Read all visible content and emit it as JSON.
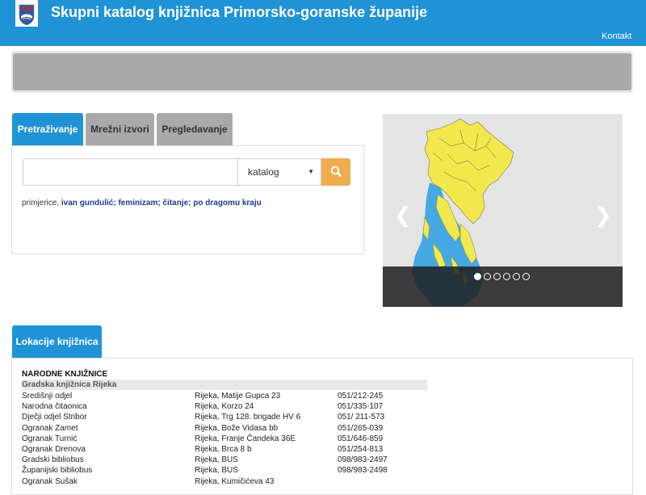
{
  "header": {
    "logo_icon": "county-coat-of-arms",
    "title": "Skupni katalog knjižnica Primorsko-goranske županije",
    "nav_contact": "Kontakt",
    "background": "#1f93d6"
  },
  "search": {
    "tabs": [
      {
        "label": "Pretraživanje",
        "active": true
      },
      {
        "label": "Mrežni izvori",
        "active": false
      },
      {
        "label": "Pregledavanje",
        "active": false
      }
    ],
    "input_value": "",
    "input_placeholder": "",
    "select_value": "katalog",
    "button_icon": "search-icon",
    "button_color": "#f0ad4e",
    "examples_prefix": "primjerice,",
    "examples": [
      "ivan gundulić;",
      "feminizam;",
      "čitanje;",
      "po dragomu kraju"
    ]
  },
  "carousel": {
    "prev_icon": "chevron-left-icon",
    "next_icon": "chevron-right-icon",
    "slide_icon": "county-map-image",
    "slide_count": 6,
    "active_slide": 1
  },
  "locations": {
    "tab_label": "Lokacije knjižnica",
    "heading": "NARODNE KNJIŽNICE",
    "subheading": "Gradska knjižnica Rijeka",
    "rows": [
      {
        "name": "Središnji odjel",
        "address": "Rijeka, Matije Gupca 23",
        "phone": "051/212-245"
      },
      {
        "name": "Narodna čitaonica",
        "address": "Rijeka, Korzo 24",
        "phone": "051/335-107"
      },
      {
        "name": "Dječji odjel Stribor",
        "address": "Rijeka, Trg 128. brigade HV 6",
        "phone": "051/ 211-573"
      },
      {
        "name": "Ogranak Zamet",
        "address": "Rijeka, Bože Vidasa bb",
        "phone": "051/265-039"
      },
      {
        "name": "Ogranak Turnić",
        "address": "Rijeka, Franje Čandeka 36E",
        "phone": "051/646-859"
      },
      {
        "name": "Ogranak Drenova",
        "address": "Rijeka, Brca 8 b",
        "phone": "051/254-813"
      },
      {
        "name": "Gradski bibliobus",
        "address": "Rijeka, BUS",
        "phone": "098/983-2497"
      },
      {
        "name": "Županijski bibliobus",
        "address": "Rijeka, BUS",
        "phone": "098/983-2498"
      },
      {
        "name": "Ogranak Sušak",
        "address": "Rijeka, Kumičićeva 43",
        "phone": ""
      }
    ]
  }
}
